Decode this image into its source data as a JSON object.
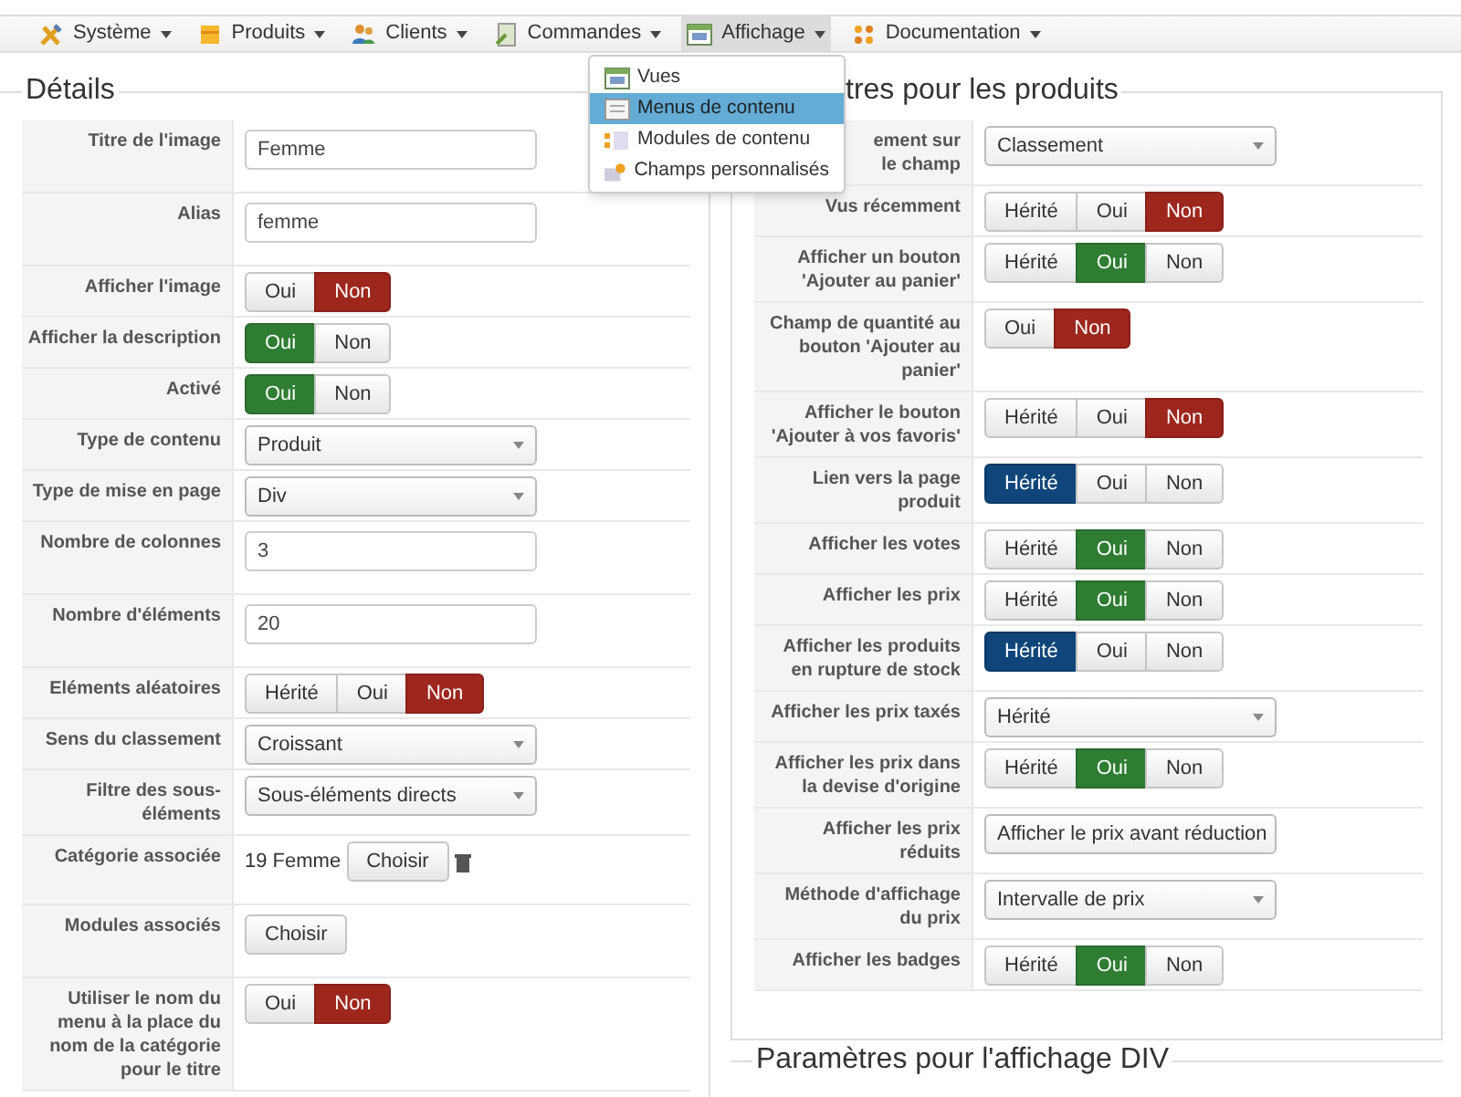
{
  "menu": [
    {
      "label": "Système",
      "active": false
    },
    {
      "label": "Produits",
      "active": false
    },
    {
      "label": "Clients",
      "active": false
    },
    {
      "label": "Commandes",
      "active": false
    },
    {
      "label": "Affichage",
      "active": true
    },
    {
      "label": "Documentation",
      "active": false
    }
  ],
  "dropdown": [
    {
      "label": "Vues",
      "selected": false
    },
    {
      "label": "Menus de contenu",
      "selected": true
    },
    {
      "label": "Modules de contenu",
      "selected": false
    },
    {
      "label": "Champs personnalisés",
      "selected": false
    }
  ],
  "left": {
    "title": "Détails",
    "rows": [
      {
        "label": "Titre de l'image",
        "kind": "text",
        "value": "Femme"
      },
      {
        "label": "Alias",
        "kind": "text",
        "value": "femme"
      },
      {
        "label": "Afficher l'image",
        "kind": "toggle",
        "options": [
          {
            "label": "Oui",
            "selected": false
          },
          {
            "label": "Non",
            "selected": true
          }
        ]
      },
      {
        "label": "Afficher la description",
        "kind": "toggle",
        "options": [
          {
            "label": "Oui",
            "selected": true
          },
          {
            "label": "Non",
            "selected": false
          }
        ]
      },
      {
        "label": "Activé",
        "kind": "toggle",
        "options": [
          {
            "label": "Oui",
            "selected": true
          },
          {
            "label": "Non",
            "selected": false
          }
        ]
      },
      {
        "label": "Type de contenu",
        "kind": "select",
        "value": "Produit"
      },
      {
        "label": "Type de mise en page",
        "kind": "select",
        "value": "Div"
      },
      {
        "label": "Nombre de colonnes",
        "kind": "text",
        "value": "3"
      },
      {
        "label": "Nombre d'éléments",
        "kind": "text",
        "value": "20"
      },
      {
        "label": "Eléments aléatoires",
        "kind": "toggle",
        "options": [
          {
            "label": "Hérité",
            "selected": false
          },
          {
            "label": "Oui",
            "selected": false
          },
          {
            "label": "Non",
            "selected": true
          }
        ]
      },
      {
        "label": "Sens du classement",
        "kind": "select",
        "value": "Croissant"
      },
      {
        "label": "Filtre des sous-éléments",
        "kind": "select",
        "value": "Sous-éléments directs"
      },
      {
        "label": "Catégorie associée",
        "kind": "category",
        "value": "19 Femme",
        "button": "Choisir"
      },
      {
        "label": "Modules associés",
        "kind": "button",
        "button": "Choisir"
      },
      {
        "label": "Utiliser le nom du menu à la place du nom de la catégorie pour le titre",
        "kind": "toggle",
        "options": [
          {
            "label": "Oui",
            "selected": false
          },
          {
            "label": "Non",
            "selected": true
          }
        ]
      }
    ]
  },
  "right": {
    "title": "tres pour les produits",
    "rows": [
      {
        "label": "ement sur le champ",
        "kind": "select",
        "value": "Classement"
      },
      {
        "label": "Vus récemment",
        "kind": "toggle",
        "options": [
          {
            "label": "Hérité",
            "selected": false
          },
          {
            "label": "Oui",
            "selected": false
          },
          {
            "label": "Non",
            "selected": true
          }
        ]
      },
      {
        "label": "Afficher un bouton 'Ajouter au panier'",
        "kind": "toggle",
        "options": [
          {
            "label": "Hérité",
            "selected": false
          },
          {
            "label": "Oui",
            "selected": true
          },
          {
            "label": "Non",
            "selected": false
          }
        ]
      },
      {
        "label": "Champ de quantité au bouton 'Ajouter au panier'",
        "kind": "toggle",
        "options": [
          {
            "label": "Oui",
            "selected": false
          },
          {
            "label": "Non",
            "selected": true
          }
        ]
      },
      {
        "label": "Afficher le bouton 'Ajouter à vos favoris'",
        "kind": "toggle",
        "options": [
          {
            "label": "Hérité",
            "selected": false
          },
          {
            "label": "Oui",
            "selected": false
          },
          {
            "label": "Non",
            "selected": true
          }
        ]
      },
      {
        "label": "Lien vers la page produit",
        "kind": "toggle",
        "options": [
          {
            "label": "Hérité",
            "selected": true
          },
          {
            "label": "Oui",
            "selected": false
          },
          {
            "label": "Non",
            "selected": false
          }
        ]
      },
      {
        "label": "Afficher les votes",
        "kind": "toggle",
        "options": [
          {
            "label": "Hérité",
            "selected": false
          },
          {
            "label": "Oui",
            "selected": true
          },
          {
            "label": "Non",
            "selected": false
          }
        ]
      },
      {
        "label": "Afficher les prix",
        "kind": "toggle",
        "options": [
          {
            "label": "Hérité",
            "selected": false
          },
          {
            "label": "Oui",
            "selected": true
          },
          {
            "label": "Non",
            "selected": false
          }
        ]
      },
      {
        "label": "Afficher les produits en rupture de stock",
        "kind": "toggle",
        "options": [
          {
            "label": "Hérité",
            "selected": true
          },
          {
            "label": "Oui",
            "selected": false
          },
          {
            "label": "Non",
            "selected": false
          }
        ]
      },
      {
        "label": "Afficher les prix taxés",
        "kind": "select",
        "value": "Hérité"
      },
      {
        "label": "Afficher les prix dans la devise d'origine",
        "kind": "toggle",
        "options": [
          {
            "label": "Hérité",
            "selected": false
          },
          {
            "label": "Oui",
            "selected": true
          },
          {
            "label": "Non",
            "selected": false
          }
        ]
      },
      {
        "label": "Afficher les prix réduits",
        "kind": "select",
        "value": "Afficher le prix avant réduction"
      },
      {
        "label": "Méthode d'affichage du prix",
        "kind": "select",
        "value": "Intervalle de prix"
      },
      {
        "label": "Afficher les badges",
        "kind": "toggle",
        "options": [
          {
            "label": "Hérité",
            "selected": false
          },
          {
            "label": "Oui",
            "selected": true
          },
          {
            "label": "Non",
            "selected": false
          }
        ]
      }
    ]
  },
  "next_section": {
    "title": "Paramètres pour l'affichage DIV"
  }
}
